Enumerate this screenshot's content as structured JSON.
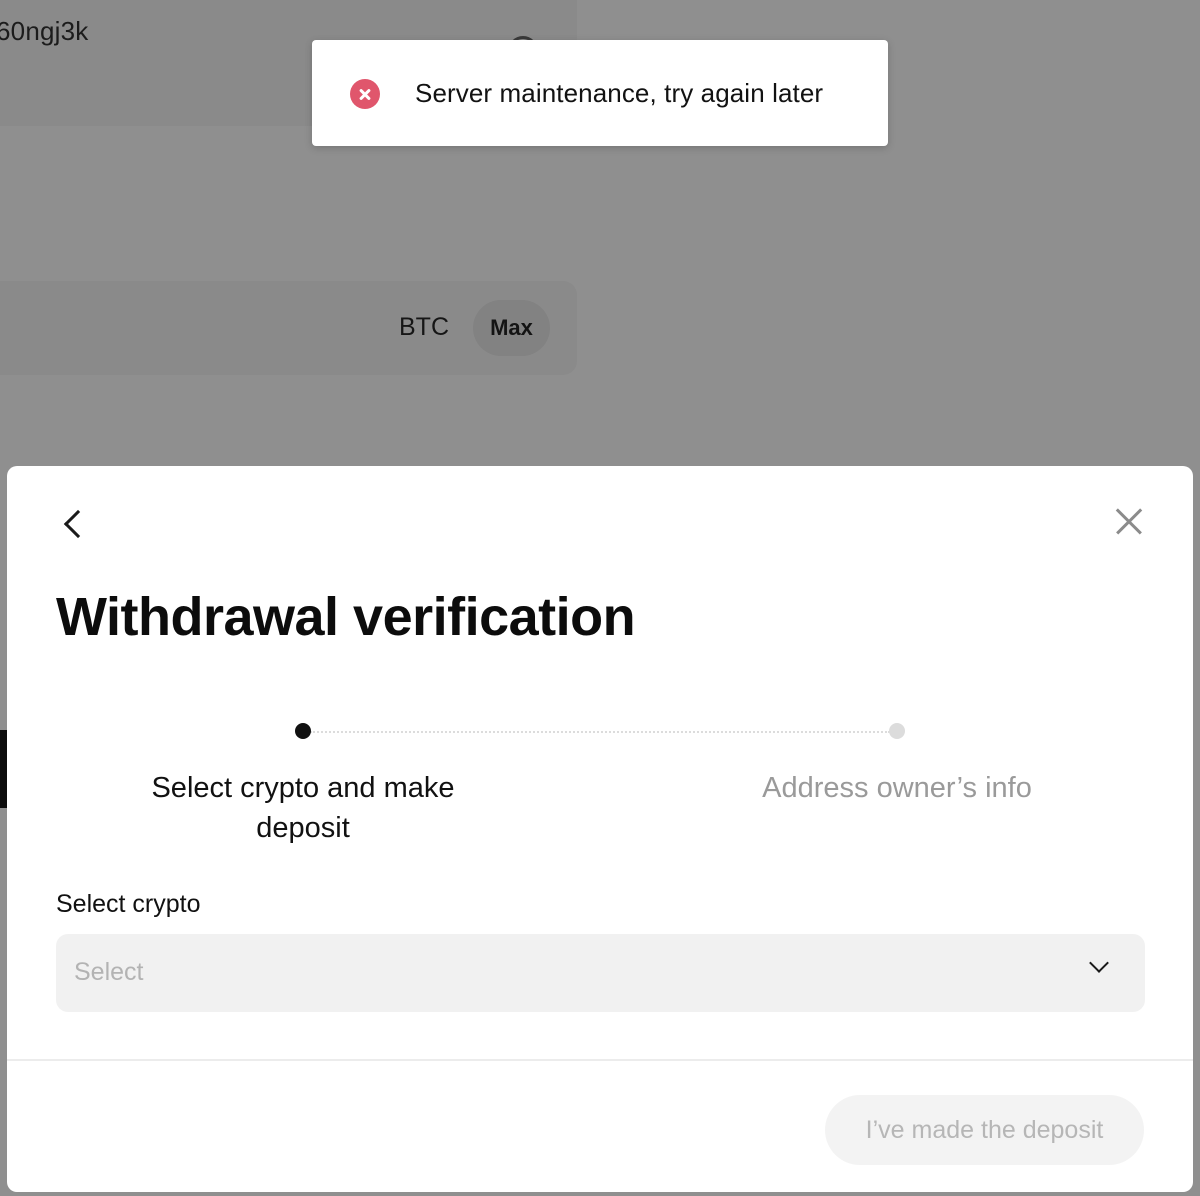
{
  "background": {
    "address_text": "60ngj3k",
    "currency": "BTC",
    "max_label": "Max"
  },
  "toast": {
    "type": "error",
    "icon": "error-circle-icon",
    "message": "Server maintenance, try again later",
    "accent_color": "#e0566c"
  },
  "modal": {
    "back_icon": "chevron-left-icon",
    "close_icon": "close-icon",
    "title": "Withdrawal verification",
    "steps": [
      {
        "label": "Select crypto and make deposit",
        "active": true
      },
      {
        "label": "Address owner’s info",
        "active": false
      }
    ],
    "select_crypto": {
      "label": "Select crypto",
      "placeholder": "Select",
      "icon": "chevron-down-icon"
    },
    "primary_button": {
      "label": "I’ve made the deposit",
      "disabled": true
    }
  }
}
